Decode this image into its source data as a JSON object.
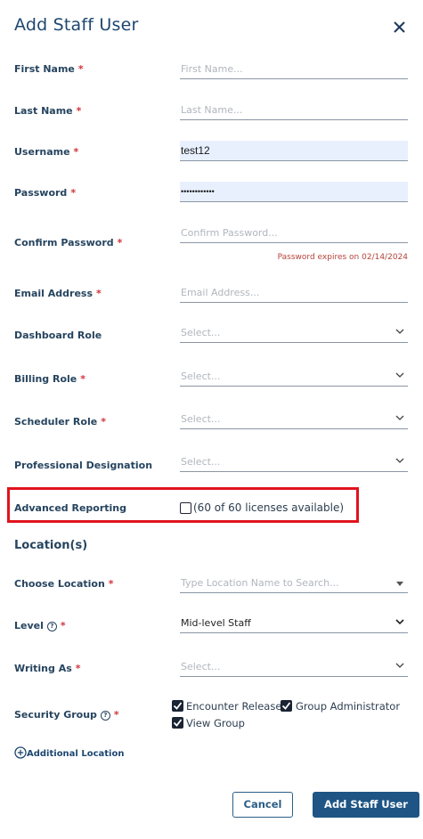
{
  "dialog": {
    "title": "Add Staff User"
  },
  "fields": {
    "first_name": {
      "label": "First Name",
      "placeholder": "First Name..."
    },
    "last_name": {
      "label": "Last Name",
      "placeholder": "Last Name..."
    },
    "username": {
      "label": "Username",
      "value": "test12"
    },
    "password": {
      "label": "Password",
      "value": "••••••••••••"
    },
    "confirm_password": {
      "label": "Confirm Password",
      "placeholder": "Confirm Password...",
      "hint": "Password expires on 02/14/2024"
    },
    "email": {
      "label": "Email Address",
      "placeholder": "Email Address..."
    },
    "dashboard_role": {
      "label": "Dashboard Role",
      "placeholder": "Select..."
    },
    "billing_role": {
      "label": "Billing Role",
      "placeholder": "Select..."
    },
    "scheduler_role": {
      "label": "Scheduler Role",
      "placeholder": "Select..."
    },
    "professional_designation": {
      "label": "Professional Designation",
      "placeholder": "Select..."
    }
  },
  "advanced_reporting": {
    "label": "Advanced Reporting",
    "licenses_text": "(60 of 60 licenses available)",
    "checked": false
  },
  "locations": {
    "section_title": "Location(s)",
    "choose_location": {
      "label": "Choose Location",
      "placeholder": "Type Location Name to Search..."
    },
    "level": {
      "label": "Level",
      "value": "Mid-level Staff"
    },
    "writing_as": {
      "label": "Writing As",
      "placeholder": "Select..."
    },
    "security_group": {
      "label": "Security Group",
      "options": [
        {
          "label": "Encounter Release",
          "checked": true
        },
        {
          "label": "Group Administrator",
          "checked": true
        },
        {
          "label": "View Group",
          "checked": true
        }
      ]
    },
    "additional_location": "Additional Location"
  },
  "actions": {
    "cancel": "Cancel",
    "add": "Add Staff User"
  },
  "required_marker": "*",
  "colors": {
    "primary": "#1e5585",
    "required": "#d0343c",
    "highlight": "#e0141e",
    "autofill": "#e8f0fe"
  }
}
